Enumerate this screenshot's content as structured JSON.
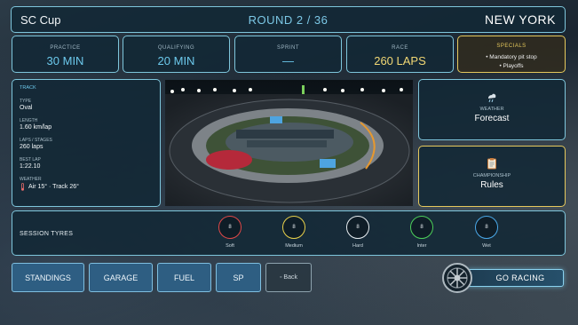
{
  "header": {
    "series": "SC Cup",
    "round": "ROUND 2 / 36",
    "location": "NEW YORK"
  },
  "sessions": {
    "practice": {
      "label": "PRACTICE",
      "value": "30 MIN"
    },
    "qualifying": {
      "label": "QUALIFYING",
      "value": "20 MIN"
    },
    "sprint": {
      "label": "SPRINT",
      "value": "—"
    },
    "race": {
      "label": "RACE",
      "value": "260 LAPS"
    },
    "specials": {
      "label": "SPECIALS",
      "items": [
        "• Mandatory pit stop",
        "• Playoffs"
      ]
    }
  },
  "track": {
    "header": "TRACK",
    "type_label": "TYPE",
    "type": "Oval",
    "length_label": "LENGTH",
    "length": "1.60 km/lap",
    "laps_label": "LAPS / STAGES",
    "laps": "260 laps",
    "best_lap_label": "BEST LAP",
    "best_lap": "1:22.10",
    "weather_label": "WEATHER",
    "weather": "Air 15° · Track 26°"
  },
  "cards": {
    "weather": {
      "label": "WEATHER",
      "value": "Forecast",
      "icon": "weather-icon"
    },
    "championship": {
      "label": "CHAMPIONSHIP",
      "value": "Rules",
      "icon": "clipboard-icon"
    }
  },
  "tyres": {
    "label": "SESSION TYRES",
    "items": [
      {
        "name": "Soft",
        "count": "8",
        "color": "#e04848"
      },
      {
        "name": "Medium",
        "count": "8",
        "color": "#e8d04a"
      },
      {
        "name": "Hard",
        "count": "8",
        "color": "#e8eef2"
      },
      {
        "name": "Inter",
        "count": "8",
        "color": "#4ccf5a"
      },
      {
        "name": "Wet",
        "count": "8",
        "color": "#4aa8e8"
      }
    ]
  },
  "buttons": {
    "standings": "STANDINGS",
    "garage": "GARAGE",
    "fuel": "FUEL",
    "sp": "SP",
    "back": "◦ Back",
    "go": "GO RACING"
  },
  "colors": {
    "accent": "#7ec6dc",
    "highlight": "#e6c95c",
    "value_blue": "#6cc9ec",
    "race_gold": "#f1d774"
  }
}
